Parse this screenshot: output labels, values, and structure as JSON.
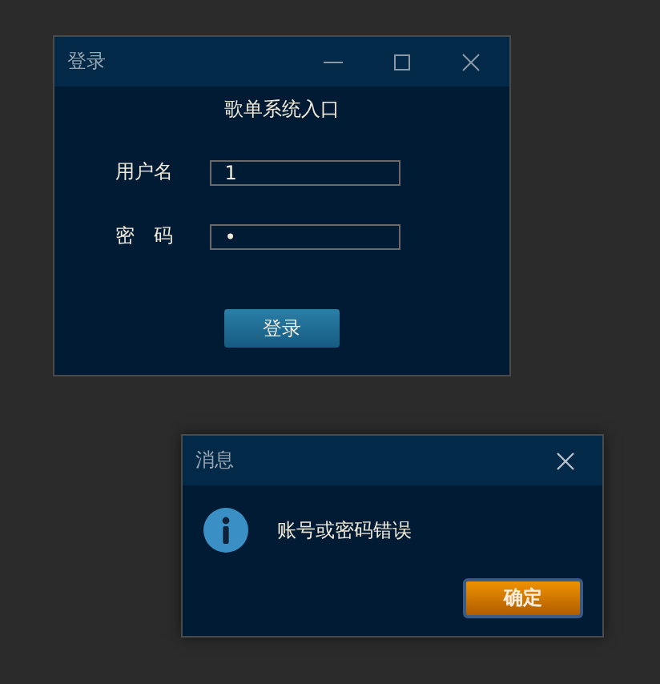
{
  "login_window": {
    "title": "登录",
    "heading": "歌单系统入口",
    "fields": [
      {
        "label": "用户名",
        "value": "1"
      },
      {
        "label": "密　码",
        "value": "•"
      }
    ],
    "button": "登录"
  },
  "message_box": {
    "title": "消息",
    "message": "账号或密码错误",
    "button": "确定"
  }
}
